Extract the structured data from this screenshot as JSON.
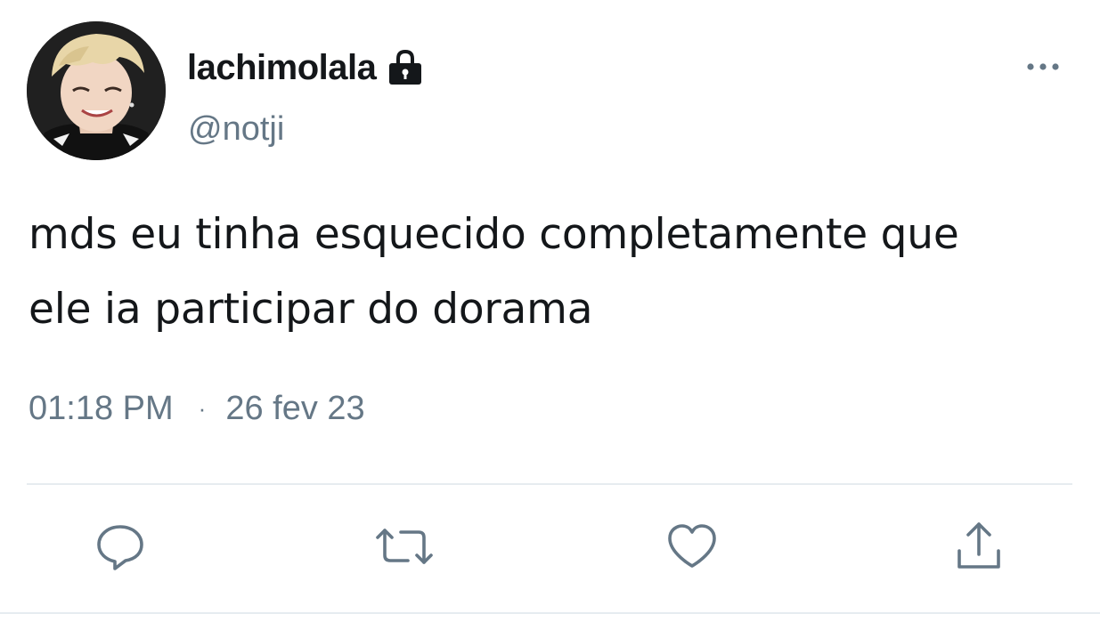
{
  "user": {
    "display_name": "lachimolala",
    "username": "@notji",
    "protected_icon": "lock-icon",
    "avatar": "profile-photo"
  },
  "tweet": {
    "text": "mds eu tinha esquecido completamente que\nele ia participar do dorama",
    "time": "01:18 PM",
    "separator": "·",
    "date": "26 fev 23"
  },
  "actions": [
    {
      "icon": "reply-icon"
    },
    {
      "icon": "retweet-icon"
    },
    {
      "icon": "like-icon"
    },
    {
      "icon": "share-icon"
    }
  ],
  "menu": {
    "icon": "more-icon"
  },
  "colors": {
    "text": "#14171a",
    "secondary": "#657786",
    "divider": "#e6ecf0",
    "background": "#ffffff"
  }
}
